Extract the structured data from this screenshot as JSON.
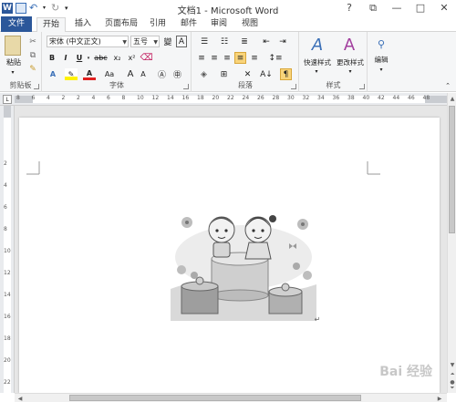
{
  "window": {
    "title": "文档1 - Microsoft Word",
    "app_icon": "W",
    "controls": {
      "help": "?",
      "restore": "⧉",
      "minimize": "—",
      "maximize": "□",
      "close": "✕"
    }
  },
  "tabs": [
    {
      "label": "文件"
    },
    {
      "label": "开始"
    },
    {
      "label": "插入"
    },
    {
      "label": "页面布局"
    },
    {
      "label": "引用"
    },
    {
      "label": "邮件"
    },
    {
      "label": "审阅"
    },
    {
      "label": "视图"
    }
  ],
  "ribbon": {
    "clipboard": {
      "paste_label": "粘贴",
      "group_label": "剪贴板"
    },
    "font": {
      "font_name": "宋体 (中文正文)",
      "font_size": "五号",
      "font_size_label": "A",
      "group_label": "字体",
      "buttons": [
        "B",
        "I",
        "U",
        "abc",
        "x₂",
        "x²",
        "A",
        "A",
        "Aa",
        "A",
        "A"
      ]
    },
    "paragraph": {
      "group_label": "段落"
    },
    "styles": {
      "quick_styles_label": "快速样式",
      "change_styles_label": "更改样式",
      "group_label": "样式"
    },
    "editing": {
      "label": "编辑"
    }
  },
  "ruler": {
    "top_labels": [
      "8",
      "6",
      "4",
      "2",
      "2",
      "4",
      "6",
      "8",
      "10",
      "12",
      "14",
      "16",
      "18",
      "20",
      "22",
      "24",
      "26",
      "28",
      "30",
      "32",
      "34",
      "36",
      "38",
      "40",
      "42",
      "44",
      "46",
      "48"
    ],
    "left_labels": [
      "2",
      "4",
      "6",
      "8",
      "10",
      "12",
      "14",
      "16",
      "18",
      "20",
      "22"
    ]
  },
  "document": {
    "paragraph_mark": "↵"
  },
  "watermark": "Bai 经验"
}
